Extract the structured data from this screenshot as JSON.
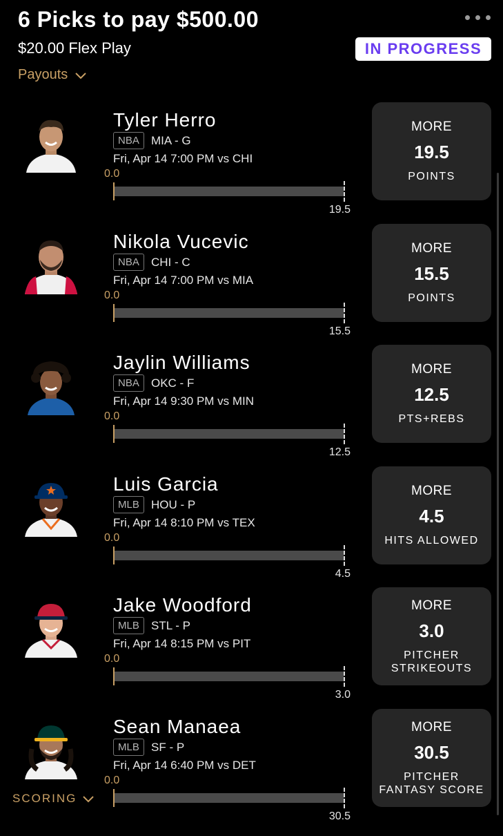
{
  "header": {
    "title": "6 Picks to pay $500.00",
    "subtitle": "$20.00 Flex Play",
    "status": "IN PROGRESS",
    "payouts_label": "Payouts",
    "scoring_label": "SCORING"
  },
  "colors": {
    "accent_gold": "#c9a065",
    "status_text": "#6a3df0",
    "card_bg": "#262626"
  },
  "picks": [
    {
      "name": "Tyler Herro",
      "league": "NBA",
      "team": "MIA - G",
      "game": "Fri, Apr 14 7:00 PM  vs CHI",
      "current": "0.0",
      "target": "19.5",
      "direction": "MORE",
      "line": "19.5",
      "stat": "POINTS"
    },
    {
      "name": "Nikola Vucevic",
      "league": "NBA",
      "team": "CHI - C",
      "game": "Fri, Apr 14 7:00 PM  vs MIA",
      "current": "0.0",
      "target": "15.5",
      "direction": "MORE",
      "line": "15.5",
      "stat": "POINTS"
    },
    {
      "name": "Jaylin Williams",
      "league": "NBA",
      "team": "OKC - F",
      "game": "Fri, Apr 14 9:30 PM  vs MIN",
      "current": "0.0",
      "target": "12.5",
      "direction": "MORE",
      "line": "12.5",
      "stat": "PTS+REBS"
    },
    {
      "name": "Luis Garcia",
      "league": "MLB",
      "team": "HOU - P",
      "game": "Fri, Apr 14 8:10 PM  vs TEX",
      "current": "0.0",
      "target": "4.5",
      "direction": "MORE",
      "line": "4.5",
      "stat": "HITS ALLOWED"
    },
    {
      "name": "Jake Woodford",
      "league": "MLB",
      "team": "STL - P",
      "game": "Fri, Apr 14 8:15 PM  vs PIT",
      "current": "0.0",
      "target": "3.0",
      "direction": "MORE",
      "line": "3.0",
      "stat": "PITCHER STRIKEOUTS"
    },
    {
      "name": "Sean Manaea",
      "league": "MLB",
      "team": "SF - P",
      "game": "Fri, Apr 14 6:40 PM  vs DET",
      "current": "0.0",
      "target": "30.5",
      "direction": "MORE",
      "line": "30.5",
      "stat": "PITCHER FANTASY SCORE"
    }
  ]
}
